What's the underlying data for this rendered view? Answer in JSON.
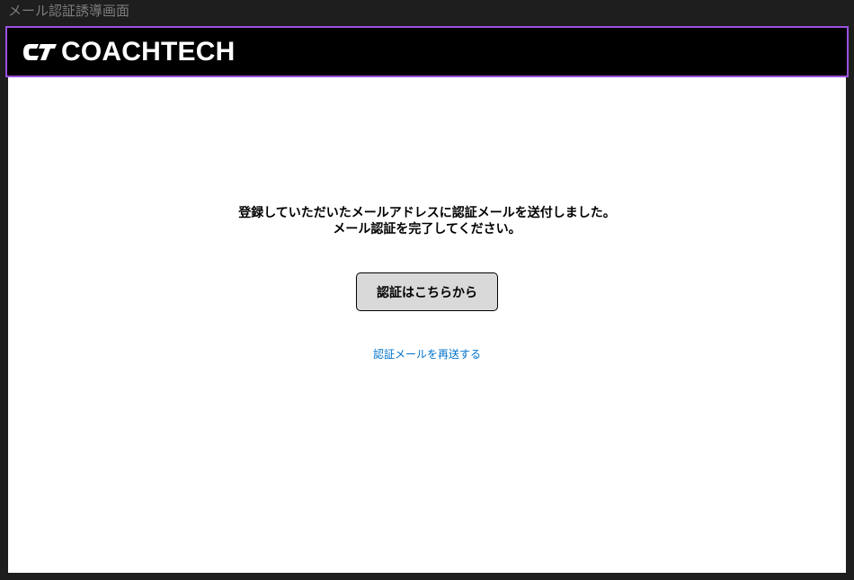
{
  "window": {
    "title": "メール認証誘導画面"
  },
  "header": {
    "logo_text": "COACHTECH",
    "logo_icon": "ct-logo-mark"
  },
  "main": {
    "message_line1": "登録していただいたメールアドレスに認証メールを送付しました。",
    "message_line2": "メール認証を完了してください。",
    "verify_button_label": "認証はこちらから",
    "resend_link_label": "認証メールを再送する"
  },
  "colors": {
    "header_background": "#000000",
    "header_border": "#9b51e0",
    "button_background": "#d9d9d9",
    "link": "#0073cc",
    "frame_background": "#1e1e1e"
  }
}
